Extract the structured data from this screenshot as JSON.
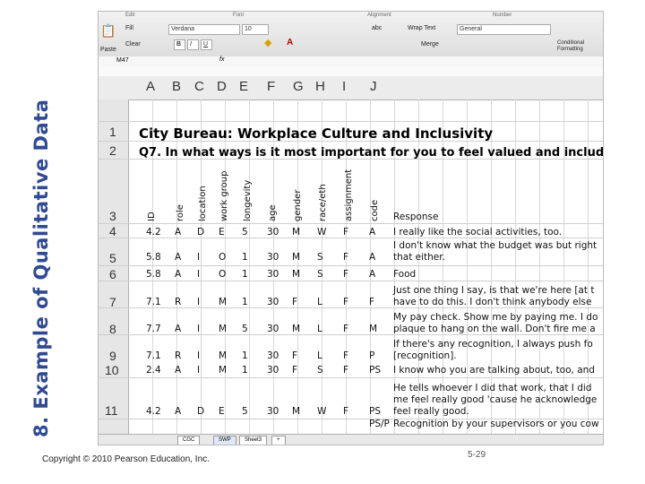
{
  "slide": {
    "title": "8. Example of Qualitative Data",
    "copyright": "Copyright © 2010 Pearson Education, Inc.",
    "page_number": "5-29"
  },
  "ribbon": {
    "groups": [
      "Edit",
      "Font",
      "Alignment",
      "Number"
    ],
    "fill": "Fill",
    "clear": "Clear",
    "paste": "Paste",
    "font_name": "Verdana",
    "font_size": "10",
    "bold": "B",
    "italic": "I",
    "underline": "U",
    "wrap_text": "Wrap Text",
    "merge": "Merge",
    "number_format": "General",
    "conditional": "Conditional Formatting",
    "abc": "abc"
  },
  "formula_bar": {
    "cell_ref": "M47",
    "fx": "fx"
  },
  "columns": [
    "A",
    "B",
    "C",
    "D",
    "E",
    "F",
    "G",
    "H",
    "I",
    "J"
  ],
  "row_numbers": [
    "1",
    "2",
    "3",
    "4",
    "5",
    "6",
    "7",
    "8",
    "9",
    "10",
    "11"
  ],
  "sheet": {
    "title": "City Bureau: Workplace Culture and Inclusivity",
    "question": "Q7. In what ways is it most important for you to feel valued and included",
    "headers": [
      "ID",
      "role",
      "location",
      "work group",
      "longevity",
      "age",
      "gender",
      "race/eth",
      "assignment",
      "code"
    ],
    "response_header": "Response",
    "rows": [
      {
        "cells": [
          "4.2",
          "A",
          "D",
          "E",
          "5",
          "30",
          "M",
          "W",
          "F",
          "A"
        ],
        "response": [
          "I really like the social activities, too."
        ]
      },
      {
        "cells": [
          "5.8",
          "A",
          "I",
          "O",
          "1",
          "30",
          "M",
          "S",
          "F",
          "A"
        ],
        "response": [
          "I don't know what the budget was but right",
          "that either."
        ]
      },
      {
        "cells": [
          "5.8",
          "A",
          "I",
          "O",
          "1",
          "30",
          "M",
          "S",
          "F",
          "A"
        ],
        "response": [
          "Food"
        ]
      },
      {
        "cells": [
          "7.1",
          "R",
          "I",
          "M",
          "1",
          "30",
          "F",
          "L",
          "F",
          "F"
        ],
        "response": [
          "Just one thing I say, is that we're here [at t",
          "have to do this. I don't think anybody else"
        ]
      },
      {
        "cells": [
          "7.7",
          "A",
          "I",
          "M",
          "5",
          "30",
          "M",
          "L",
          "F",
          "M"
        ],
        "response": [
          "My pay check. Show me by paying me. I do",
          "plaque to hang on the wall. Don't fire me a"
        ]
      },
      {
        "cells": [
          "7.1",
          "R",
          "I",
          "M",
          "1",
          "30",
          "F",
          "L",
          "F",
          "P"
        ],
        "response": [
          "If there's any recognition, I always push fo",
          "[recognition]."
        ]
      },
      {
        "cells": [
          "2.4",
          "A",
          "I",
          "M",
          "1",
          "30",
          "F",
          "S",
          "F",
          "PS"
        ],
        "response": [
          "I know who you are talking about, too, and"
        ]
      },
      {
        "cells": [
          "4.2",
          "A",
          "D",
          "E",
          "5",
          "30",
          "M",
          "W",
          "F",
          "PS"
        ],
        "response": [
          "He tells whoever I did that work, that I did",
          "me feel really good 'cause he acknowledge",
          "feel really good."
        ]
      },
      {
        "cells": [
          "",
          "",
          "",
          "",
          "",
          "",
          "",
          "",
          "",
          "PS/P"
        ],
        "response": [
          "Recognition by your supervisors or you cow"
        ]
      }
    ]
  },
  "tabs": [
    "CGC",
    "SWP",
    "Sheet3",
    "+"
  ]
}
